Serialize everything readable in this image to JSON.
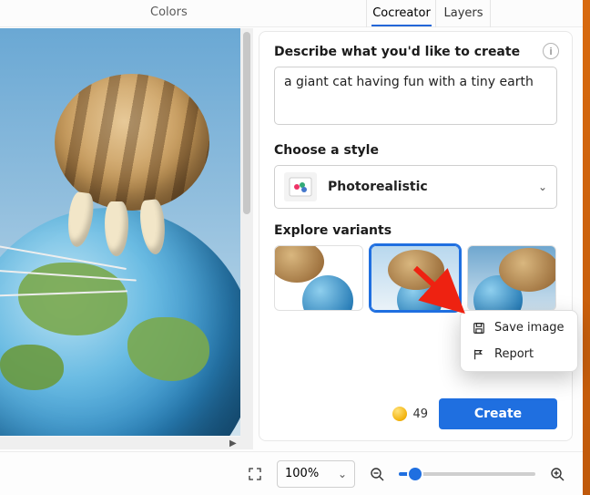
{
  "ribbon": {
    "group_label": "Colors",
    "side_tabs": {
      "cocreator": "Cocreator",
      "layers": "Layers"
    }
  },
  "panel": {
    "describe_heading": "Describe what you'd like to create",
    "prompt_value": "a giant cat having fun with a tiny earth",
    "prompt_placeholder": "Describe what you'd like to create",
    "style_heading": "Choose a style",
    "style_selected": "Photorealistic",
    "variants_heading": "Explore variants",
    "credits_count": "49",
    "create_label": "Create"
  },
  "context_menu": {
    "save": "Save image",
    "report": "Report"
  },
  "status": {
    "zoom_label": "100%"
  },
  "icons": {
    "info": "i",
    "chevron_down": "⌄",
    "zoom_out_glyph": "−",
    "zoom_in_glyph": "+"
  }
}
